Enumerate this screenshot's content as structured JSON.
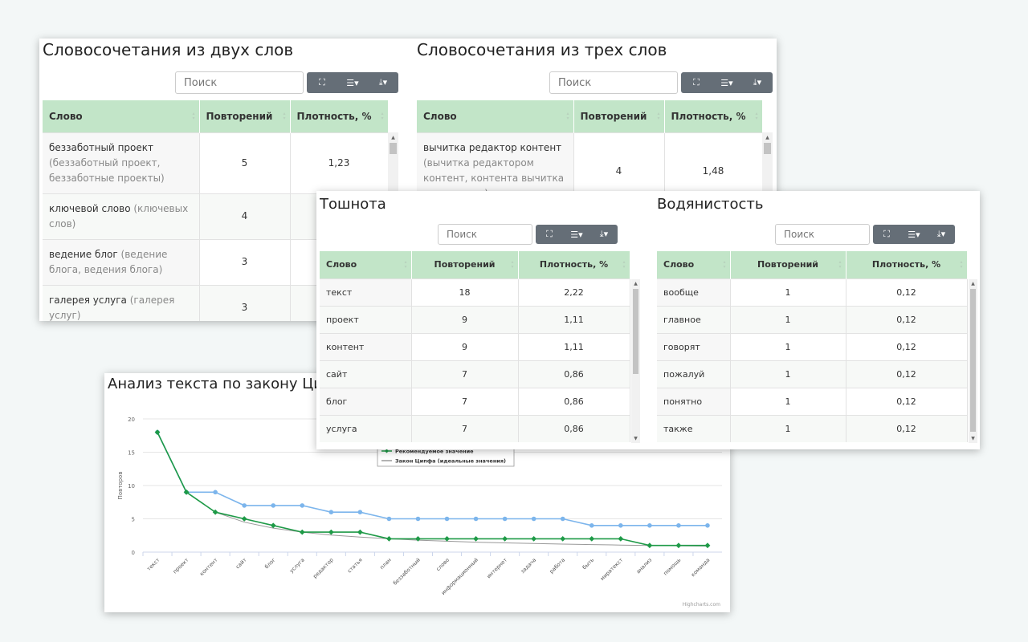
{
  "search_placeholder": "Поиск",
  "btn_icons": [
    "fullscreen-icon",
    "columns-icon",
    "export-icon"
  ],
  "btn_glyphs": [
    "⛶",
    "☰▾",
    "⤓▾"
  ],
  "columns": [
    "Слово",
    "Повторений",
    "Плотность, %"
  ],
  "two_words": {
    "title": "Словосочетания из двух слов",
    "rows": [
      {
        "word": "беззаботный проект",
        "forms": "(беззаботный проект, беззаботные проекты)",
        "count": "5",
        "density": "1,23"
      },
      {
        "word": "ключевой слово",
        "forms": "(ключевых слов)",
        "count": "4",
        "density": ""
      },
      {
        "word": "ведение блог",
        "forms": "(ведение блога, ведения блога)",
        "count": "3",
        "density": ""
      },
      {
        "word": "галерея услуга",
        "forms": "(галерея услуг)",
        "count": "3",
        "density": ""
      }
    ]
  },
  "three_words": {
    "title": "Словосочетания из трех слов",
    "rows": [
      {
        "word": "вычитка редактор контент",
        "forms": "(вычитка редактором контент, контента вычитка редактором)",
        "count": "4",
        "density": "1,48"
      }
    ]
  },
  "nausea": {
    "title": "Тошнота",
    "rows": [
      {
        "word": "текст",
        "count": "18",
        "density": "2,22"
      },
      {
        "word": "проект",
        "count": "9",
        "density": "1,11"
      },
      {
        "word": "контент",
        "count": "9",
        "density": "1,11"
      },
      {
        "word": "сайт",
        "count": "7",
        "density": "0,86"
      },
      {
        "word": "блог",
        "count": "7",
        "density": "0,86"
      },
      {
        "word": "услуга",
        "count": "7",
        "density": "0,86"
      }
    ]
  },
  "water": {
    "title": "Водянистость",
    "rows": [
      {
        "word": "вообще",
        "count": "1",
        "density": "0,12"
      },
      {
        "word": "главное",
        "count": "1",
        "density": "0,12"
      },
      {
        "word": "говорят",
        "count": "1",
        "density": "0,12"
      },
      {
        "word": "пожалуй",
        "count": "1",
        "density": "0,12"
      },
      {
        "word": "понятно",
        "count": "1",
        "density": "0,12"
      },
      {
        "word": "также",
        "count": "1",
        "density": "0,12"
      }
    ]
  },
  "chart_data": {
    "type": "line",
    "title": "Анализ текста по закону Ципфа",
    "ylabel": "Повторов",
    "xlabel": "",
    "ylim": [
      0,
      20
    ],
    "yticks": [
      0,
      5,
      10,
      15,
      20
    ],
    "grid": true,
    "legend": "center",
    "credits": "Highcharts.com",
    "categories": [
      "текст",
      "проект",
      "контент",
      "сайт",
      "блог",
      "услуга",
      "редактор",
      "статья",
      "план",
      "беззаботный",
      "слово",
      "информационный",
      "интернет",
      "задача",
      "работа",
      "быть",
      "миратекст",
      "анализ",
      "помощь",
      "команда"
    ],
    "series": [
      {
        "name": "",
        "color": "#7cb5ec",
        "marker": "circle",
        "values": [
          18,
          9,
          9,
          7,
          7,
          7,
          6,
          6,
          5,
          5,
          5,
          5,
          5,
          5,
          5,
          4,
          4,
          4,
          4,
          4
        ]
      },
      {
        "name": "Рекомендуемое значение",
        "color": "#1e9a47",
        "marker": "diamond",
        "values": [
          18,
          9,
          6,
          5,
          4,
          3,
          3,
          3,
          2,
          2,
          2,
          2,
          2,
          2,
          2,
          2,
          2,
          1,
          1,
          1
        ]
      },
      {
        "name": "Закон Ципфа (идеальные значения)",
        "color": "#999999",
        "marker": "none",
        "values": [
          18,
          9,
          6,
          4.5,
          3.6,
          3,
          2.57,
          2.25,
          2,
          1.8,
          1.64,
          1.5,
          1.38,
          1.29,
          1.2,
          1.13,
          1.06,
          1,
          0.95,
          0.9
        ]
      }
    ]
  }
}
